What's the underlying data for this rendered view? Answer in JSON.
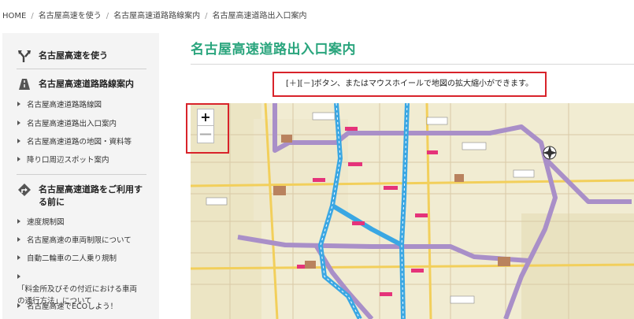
{
  "breadcrumb": [
    "HOME",
    "名古屋高速を使う",
    "名古屋高速道路路線案内",
    "名古屋高速道路出入口案内"
  ],
  "sidebar": {
    "section1": {
      "label": "名古屋高速を使う",
      "icon": "branch-arrow-icon"
    },
    "section2": {
      "label": "名古屋高速道路路線案内",
      "icon": "road-icon"
    },
    "section2_items": [
      "名古屋高速道路路線図",
      "名古屋高速道路出入口案内",
      "名古屋高速道路の地図・資料等",
      "降り口周辺スポット案内"
    ],
    "section3": {
      "label_line1": "名古屋高速道路をご利用す",
      "label_line2": "る前に",
      "icon": "turn-arrow-icon"
    },
    "section3_items": [
      "速度規制図",
      "名古屋高速の車両制限について",
      "自動二輪車の二人乗り規制"
    ],
    "section3_item_long": {
      "line1": "「料金所及びその付近における車両",
      "line2": "の通行方法」について"
    },
    "section3_item_last": "名古屋高速でECOしよう！"
  },
  "main": {
    "title": "名古屋高速道路出入口案内",
    "instruction": "[＋][－]ボタン、またはマウスホイールで地図の拡大縮小ができます。",
    "zoom_in": "+",
    "zoom_out": "—"
  },
  "colors": {
    "accent": "#2aa57d",
    "highlight": "#d8232a",
    "expressway": "#3aa7e3",
    "ring_road": "#a98fc8",
    "map_bg": "#f1ecd2"
  }
}
